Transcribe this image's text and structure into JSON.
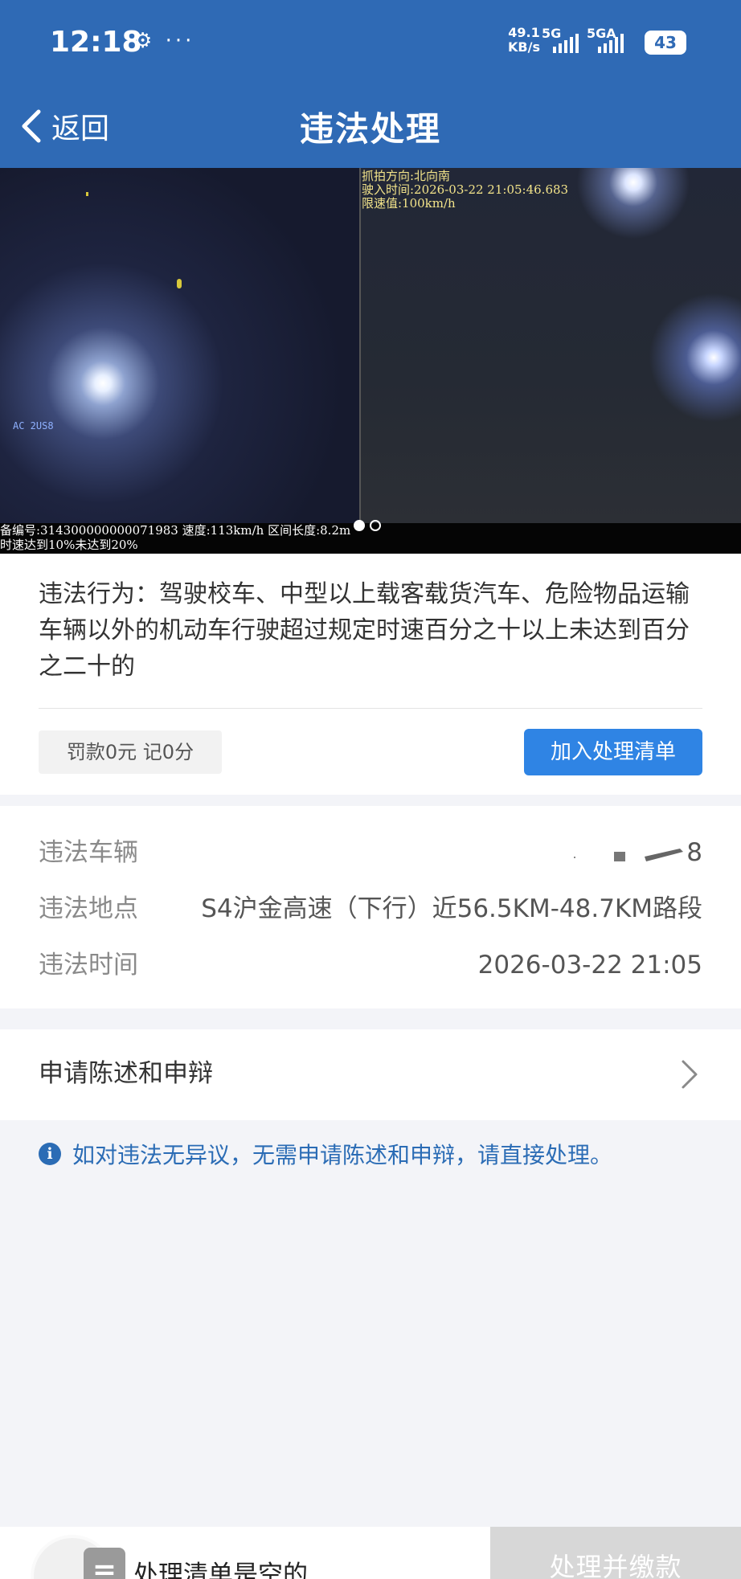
{
  "status_bar": {
    "time": "12:18",
    "notif_icons": "⚙ ···",
    "net_speed_value": "49.1",
    "net_speed_unit": "KB/s",
    "sim1": "5G",
    "sim2": "5GA",
    "battery": "43"
  },
  "nav": {
    "back_label": "返回",
    "title": "违法处理"
  },
  "photo": {
    "overlay_right_lines": [
      "抓拍方向:北向南",
      "驶入时间:2026-03-22 21:05:46.683",
      "限速值:100km/h"
    ],
    "overlay_bottom_line1": "备编号:314300000000071983   速度:113km/h  区间长度:8.2m",
    "overlay_bottom_line2": "时速达到10%未达到20%",
    "overlay_small": "AC 2US8",
    "pages": 2,
    "active_page": 1
  },
  "violation": {
    "behavior": "违法行为：驾驶校车、中型以上载客载货汽车、危险物品运输车辆以外的机动车行驶超过规定时速百分之十以上未达到百分之二十的",
    "fine_tag": "罚款0元 记0分",
    "add_button": "加入处理清单"
  },
  "details": {
    "vehicle_label": "违法车辆",
    "vehicle_value": "8",
    "location_label": "违法地点",
    "location_value": "S4沪金高速（下行）近56.5KM-48.7KM路段",
    "time_label": "违法时间",
    "time_value": "2026-03-22 21:05"
  },
  "statement": {
    "label": "申请陈述和申辩"
  },
  "notice": {
    "text": "如对违法无异议，无需申请陈述和申辩，请直接处理。"
  },
  "bottom": {
    "list_icon": "=",
    "empty_text": "处理清单是空的",
    "pay_button": "处理并缴款"
  },
  "colors": {
    "header": "#2f6ab5",
    "accent": "#2f84e4",
    "notice": "#2b6cb5"
  }
}
